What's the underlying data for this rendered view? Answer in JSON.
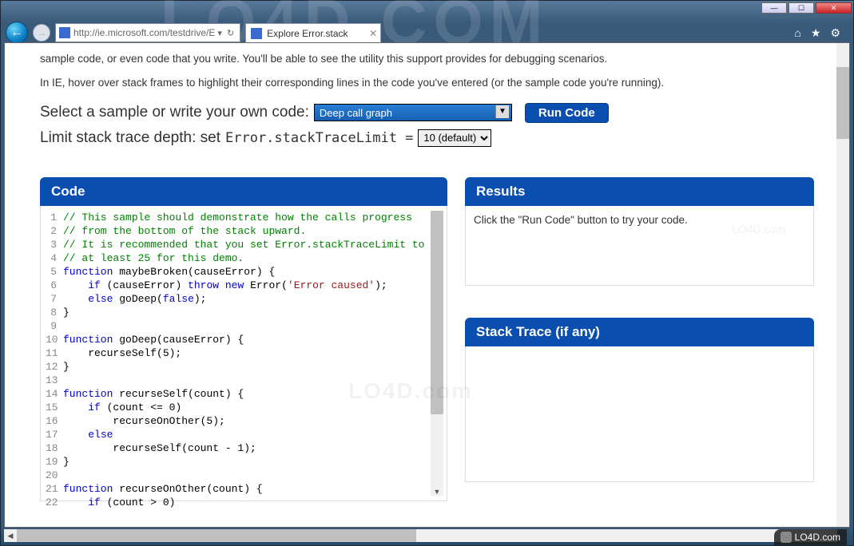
{
  "window": {
    "backdrop_text": "LO4D.COM"
  },
  "nav": {
    "url": "http://ie.microsoft.com/testdrive/E",
    "tab_title": "Explore Error.stack"
  },
  "page": {
    "intro_p1": "sample code, or even code that you write. You'll be able to see the utility this support provides for debugging scenarios.",
    "intro_p2": "In IE, hover over stack frames to highlight their corresponding lines in the code you've entered (or the sample code you're running).",
    "sample_label": "Select a sample or write your own code:",
    "sample_selected": "Deep call graph",
    "run_label": "Run Code",
    "limit_label_a": "Limit stack trace depth: set ",
    "limit_code": "Error.stackTraceLimit = ",
    "limit_selected": "10 (default)"
  },
  "panels": {
    "code_head": "Code",
    "results_head": "Results",
    "results_body": "Click the \"Run Code\" button to try your code.",
    "stack_head": "Stack Trace (if any)"
  },
  "code": {
    "lines": [
      {
        "n": 1,
        "html": "<span class='tok-c'>// This sample should demonstrate how the calls progress</span>"
      },
      {
        "n": 2,
        "html": "<span class='tok-c'>// from the bottom of the stack upward.</span>"
      },
      {
        "n": 3,
        "html": "<span class='tok-c'>// It is recommended that you set Error.stackTraceLimit to</span>"
      },
      {
        "n": 4,
        "html": "<span class='tok-c'>// at least 25 for this demo.</span>"
      },
      {
        "n": 5,
        "html": "<span class='tok-k'>function</span> maybeBroken(causeError) {"
      },
      {
        "n": 6,
        "html": "    <span class='tok-k'>if</span> (causeError) <span class='tok-k'>throw</span> <span class='tok-k'>new</span> Error(<span class='tok-s'>'Error caused'</span>);"
      },
      {
        "n": 7,
        "html": "    <span class='tok-k'>else</span> goDeep(<span class='tok-k'>false</span>);"
      },
      {
        "n": 8,
        "html": "}"
      },
      {
        "n": 9,
        "html": ""
      },
      {
        "n": 10,
        "html": "<span class='tok-k'>function</span> goDeep(causeError) {"
      },
      {
        "n": 11,
        "html": "    recurseSelf(5);"
      },
      {
        "n": 12,
        "html": "}"
      },
      {
        "n": 13,
        "html": ""
      },
      {
        "n": 14,
        "html": "<span class='tok-k'>function</span> recurseSelf(count) {"
      },
      {
        "n": 15,
        "html": "    <span class='tok-k'>if</span> (count &lt;= 0)"
      },
      {
        "n": 16,
        "html": "        recurseOnOther(5);"
      },
      {
        "n": 17,
        "html": "    <span class='tok-k'>else</span>"
      },
      {
        "n": 18,
        "html": "        recurseSelf(count - 1);"
      },
      {
        "n": 19,
        "html": "}"
      },
      {
        "n": 20,
        "html": ""
      },
      {
        "n": 21,
        "html": "<span class='tok-k'>function</span> recurseOnOther(count) {"
      },
      {
        "n": 22,
        "html": "    <span class='tok-k'>if</span> (count &gt; 0)"
      }
    ]
  },
  "watermarks": {
    "center": "LO4D.com",
    "small1": "LO4D.com",
    "small2": "LO4D.com",
    "footer": "LO4D.com"
  }
}
